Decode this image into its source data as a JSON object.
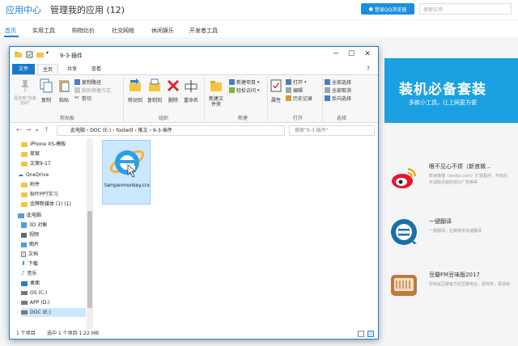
{
  "header": {
    "app_center": "应用中心",
    "manage_apps": "管理我的应用 (12)",
    "login_button": "登录QQ浏览器",
    "search_placeholder": "搜索应用"
  },
  "nav": {
    "tabs": [
      "首页",
      "实用工具",
      "购物比价",
      "社交网络",
      "休闲娱乐",
      "开发者工具"
    ]
  },
  "banner": {
    "title": "装机必备套装",
    "subtitle": "多款小工具，让上网更方便"
  },
  "side_apps": [
    {
      "name": "眼不见心不烦（新浪微...",
      "desc": "新浪微博（weibo.com）扩展程序，开启后可消除页面的部分广告等等"
    },
    {
      "name": "一键翻译",
      "desc": "一键翻译，右键菜单快速翻译"
    },
    {
      "name": "豆瓣FM豆味版2017",
      "desc": "原味是豆瓣官方的豆瓣电台，更简单，更清晰"
    }
  ],
  "colors": {
    "accent": "#1a7fd4",
    "banner": "#1ba1e2",
    "weibo": "#e6162d",
    "translate": "#1a6fa8",
    "douban": "#c07a3a",
    "file_tab": "#1979ca"
  },
  "explorer": {
    "title": "9-3-插件",
    "ribbon_tabs": [
      "文件",
      "主页",
      "共享",
      "查看"
    ],
    "groups": [
      "剪贴板",
      "组织",
      "新建",
      "打开",
      "选择"
    ],
    "buttons": {
      "pin": "固定到\"快速访问\"",
      "copy": "复制",
      "paste": "粘贴",
      "copy_path": "复制路径",
      "paste_shortcut": "粘贴快捷方式",
      "cut": "剪切",
      "move_to": "移动到",
      "copy_to": "复制到",
      "delete": "删除",
      "rename": "重命名",
      "new_folder": "新建文件夹",
      "new_item": "新建项目",
      "easy_access": "轻松访问",
      "properties": "属性",
      "open": "打开",
      "edit": "编辑",
      "history": "历史记录",
      "select_all": "全部选择",
      "select_none": "全部取消",
      "invert_selection": "反向选择"
    },
    "address": {
      "path": [
        "此电脑",
        "DOC (E:)",
        "foolwill",
        "推文",
        "9-3-插件"
      ],
      "search_placeholder": "搜索\"9-3-插件\""
    },
    "nav_items": [
      "iPhone XS-模板",
      "草案",
      "文案9-17",
      "OneDrive",
      "附件",
      "秋叶PPT实习",
      "金牌新媒体 (1) (1)",
      "此电脑",
      "3D 对象",
      "视频",
      "图片",
      "文档",
      "下载",
      "音乐",
      "桌面",
      "OS (C:)",
      "APP (D:)",
      "DOC (E:)"
    ],
    "file": {
      "name": "tampermonkey.crx"
    },
    "status": {
      "count": "1 个项目",
      "selected": "选中 1 个项目 1.22 MB"
    }
  },
  "window_controls": {
    "minimize": "─",
    "maximize": "☐",
    "close": "✕"
  }
}
